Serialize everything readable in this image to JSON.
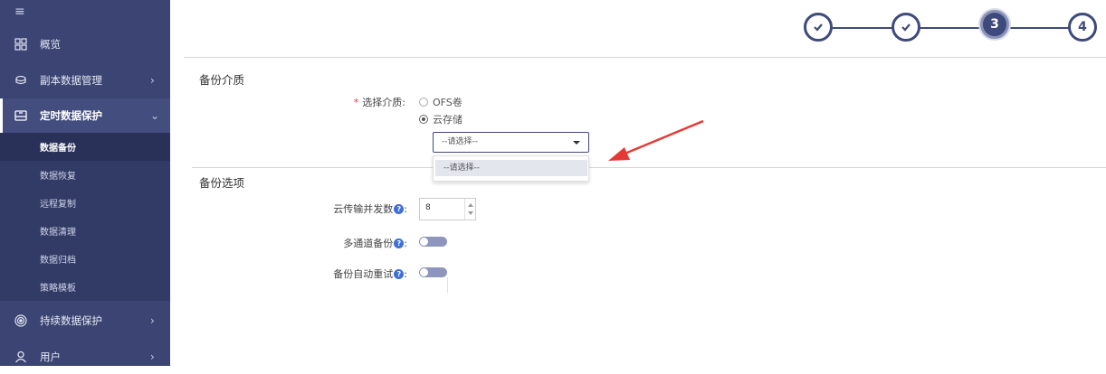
{
  "sidebar": {
    "menu_icon": "menu-icon",
    "items": [
      {
        "label": "概览",
        "icon": "grid-icon"
      },
      {
        "label": "副本数据管理",
        "icon": "copy-data-icon"
      },
      {
        "label": "定时数据保护",
        "icon": "schedule-protect-icon"
      },
      {
        "label": "持续数据保护",
        "icon": "continuous-protect-icon"
      },
      {
        "label": "用户",
        "icon": "user-icon"
      }
    ],
    "subitems": [
      "数据备份",
      "数据恢复",
      "远程复制",
      "数据清理",
      "数据归档",
      "策略模板"
    ],
    "selected_subitem": "数据备份"
  },
  "steps": {
    "items": [
      {
        "label": "",
        "state": "done"
      },
      {
        "label": "",
        "state": "done"
      },
      {
        "label": "3",
        "state": "current"
      },
      {
        "label": "4",
        "state": "pending"
      }
    ]
  },
  "media_section": {
    "title": "备份介质",
    "field_label": "选择介质:",
    "required_mark": "*",
    "options": [
      "OFS卷",
      "云存储"
    ],
    "selected": "云存储",
    "select_value": "--请选择--",
    "dropdown_options": [
      "--请选择--"
    ]
  },
  "options_section": {
    "title": "备份选项",
    "concurrency_label": "云传输并发数",
    "concurrency_value": "8",
    "multichannel_label": "多通道备份",
    "multichannel_on": false,
    "auto_retry_label": "备份自动重试",
    "auto_retry_on": false,
    "help_glyph": "?",
    "label_suffix": ":"
  },
  "colors": {
    "sidebar_bg": "#3b4472",
    "accent": "#3e4a7c",
    "arrow": "#e53935",
    "help": "#3d6fd8"
  }
}
